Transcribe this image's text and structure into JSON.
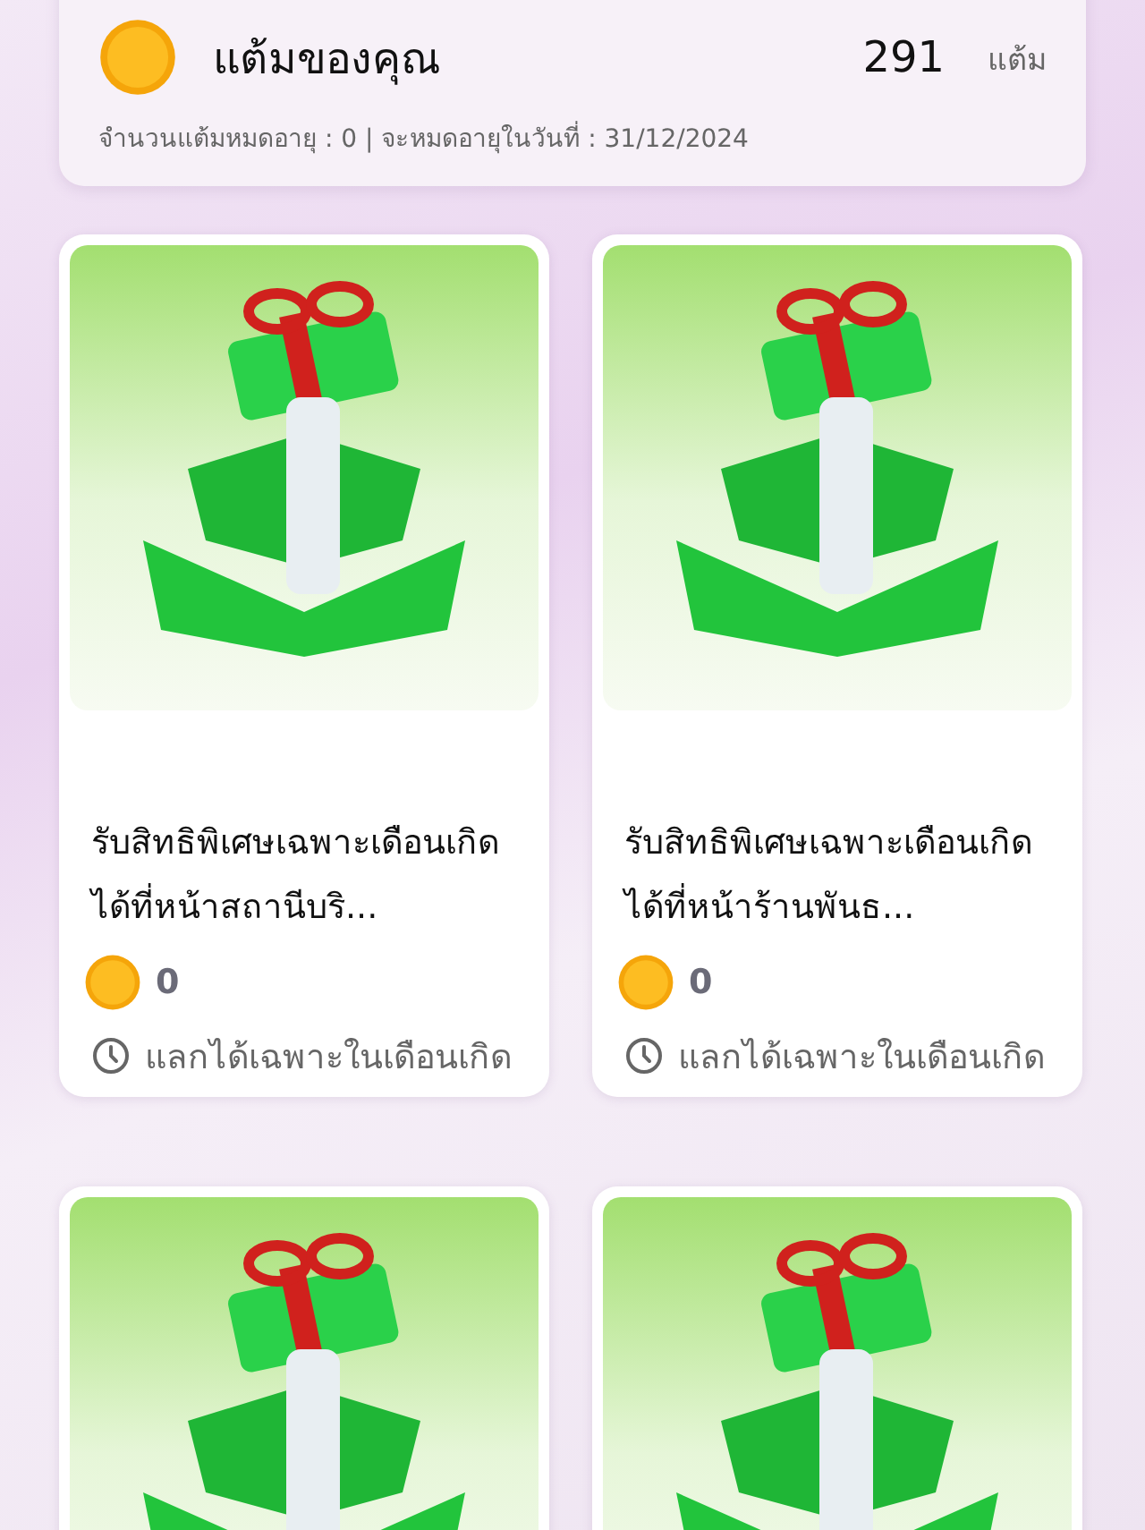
{
  "points_card": {
    "title": "แต้มของคุณ",
    "points": "291",
    "unit": "แต้ม",
    "expiry_text": "จำนวนแต้มหมดอายุ : 0 | จะหมดอายุในวันที่ : 31/12/2024"
  },
  "rewards": [
    {
      "kind": "full",
      "title": "รับสิทธิพิเศษเฉพาะเดือนเกิดได้ที่หน้าสถานีบริ...",
      "cost": "0",
      "note": "แลกได้เฉพาะในเดือนเกิด"
    },
    {
      "kind": "full",
      "title": "รับสิทธิพิเศษเฉพาะเดือนเกิดได้ที่หน้าร้านพันธ...",
      "cost": "0",
      "note": "แลกได้เฉพาะในเดือนเกิด"
    },
    {
      "kind": "cut"
    },
    {
      "kind": "cut"
    }
  ]
}
